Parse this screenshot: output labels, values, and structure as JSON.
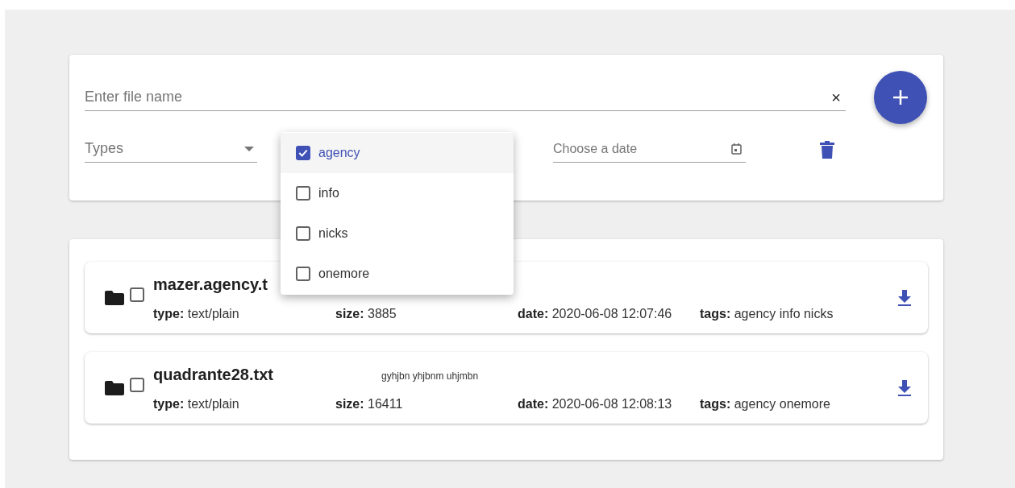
{
  "search": {
    "placeholder": "Enter file name",
    "clear": "×"
  },
  "filters": {
    "types": {
      "placeholder": "Types"
    },
    "date": {
      "placeholder": "Choose a date"
    }
  },
  "tags_menu": [
    {
      "label": "agency",
      "checked": true,
      "selected": true
    },
    {
      "label": "info",
      "checked": false,
      "selected": false
    },
    {
      "label": "nicks",
      "checked": false,
      "selected": false
    },
    {
      "label": "onemore",
      "checked": false,
      "selected": false
    }
  ],
  "files": [
    {
      "name": "mazer.agency.t",
      "checked": false,
      "fields": [
        {
          "label": "type:",
          "value": "text/plain"
        },
        {
          "label": "size:",
          "value": "3885"
        },
        {
          "label": "date:",
          "value": "2020-06-08 12:07:46"
        },
        {
          "label": "tags:",
          "value": "agency info nicks"
        }
      ]
    },
    {
      "name": "quadrante28.txt",
      "description": "gyhjbn yhjbnm uhjmbn",
      "checked": false,
      "fields": [
        {
          "label": "type:",
          "value": "text/plain"
        },
        {
          "label": "size:",
          "value": "16411"
        },
        {
          "label": "date:",
          "value": "2020-06-08 12:08:13"
        },
        {
          "label": "tags:",
          "value": "agency onemore"
        }
      ]
    }
  ]
}
